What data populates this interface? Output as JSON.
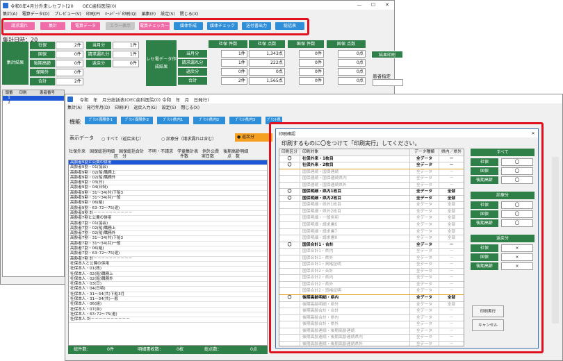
{
  "win1": {
    "title": "令和0年4月分外来レセプト[20　　OEC歯科医院(0)",
    "menu": [
      "集計(A)",
      "電算データ(D)",
      "プレビュー(V)",
      "印刷(P)",
      "ﾎｰﾑﾍﾟｰｼﾞ印刷(Q)",
      "編集(E)",
      "設定(S)",
      "閉じる(X)"
    ],
    "buttons": [
      "請求漏れ",
      "集計",
      "電算データ",
      "エラー表示",
      "電算チェッカー",
      "媒体作成",
      "媒体チェック",
      "送付書出力",
      "総括表"
    ],
    "date_label": "集計日時：20",
    "summary": {
      "group_label": "集計結果",
      "rows": [
        {
          "label": "社保",
          "value": "2件"
        },
        {
          "label": "国保",
          "value": "0件"
        },
        {
          "label": "後期高齢",
          "value": "0件"
        },
        {
          "label": "保険外",
          "value": "0件"
        },
        {
          "label": "合計",
          "value": "2件"
        }
      ],
      "col2": [
        {
          "label": "当月分",
          "value": "1件"
        },
        {
          "label": "請求漏れ分",
          "value": "1件"
        },
        {
          "label": "返戻分",
          "value": "0件"
        }
      ]
    },
    "rezept": {
      "group_label": "レセ電データ作成結果",
      "headers": [
        "社保 件数",
        "社保 点数",
        "国保 件数",
        "国保 点数"
      ],
      "rows": [
        {
          "label": "当月分",
          "v": [
            "1件",
            "1,343点",
            "0件",
            "0点"
          ]
        },
        {
          "label": "請求漏れ分",
          "v": [
            "1件",
            "222点",
            "0件",
            "0点"
          ]
        },
        {
          "label": "返戻分",
          "v": [
            "0件",
            "0点",
            "0件",
            "0点"
          ]
        },
        {
          "label": "合計",
          "v": [
            "2件",
            "1,565点",
            "0件",
            "0点"
          ]
        }
      ]
    },
    "print_btn": "結果印刷",
    "patient_label": "患者指定",
    "grid_headers": [
      "頭番",
      "印刷",
      "患者番号"
    ],
    "grid_rows": [
      [
        "1",
        "",
        ""
      ],
      [
        "2",
        "",
        ""
      ]
    ]
  },
  "win2": {
    "title": "　令和　年　月分総括表(OEC歯科医院(0)   令和　年　月　日発行)",
    "menu": [
      "集計(A)",
      "発行年月(D)",
      "印刷(P)",
      "返戻入力(G)",
      "設定(S)",
      "閉じる(X)"
    ],
    "func_label": "機能",
    "func_buttons": [
      "ﾌﾟﾘﾝﾄ保険外1",
      "ﾌﾟﾘﾝﾄ保険外2",
      "ﾌﾟﾘﾝﾄ県内1",
      "ﾌﾟﾘﾝﾄ県内2",
      "ﾌﾟﾘﾝﾄ県内3",
      "ﾌﾟﾘﾝﾄ県外4"
    ],
    "display_label": "表示データ",
    "radios": [
      "すべて（返戻含む）",
      "診療分（請求漏れは含む）",
      "返戻分"
    ],
    "tabs": [
      "社保外来",
      "国保総括明細",
      "国保総括合計",
      "不明・不請求",
      "学童集計表",
      "例外公費",
      "後期高齢明細"
    ],
    "table_headers": [
      "区　分",
      "件数",
      "実日数",
      "点　数"
    ],
    "rows": [
      "高齢者9割と公費の併用",
      "高齢者9割・01(協会)",
      "高齢者9割・02(船)職務上",
      "高齢者9割・02(船)職務外",
      "高齢者9割・03(日)",
      "高齢者9割・04(日特)",
      "高齢者9割・31～34(共)下船3",
      "高齢者9割・31～34(共)一般",
      "高齢者9割・06(組)",
      "高齢者9割・63･72～75(退)",
      "高齢者9割 計－－－－－－－－－－",
      "高齢者7割と公費の併用",
      "高齢者7割・01(協会)",
      "高齢者7割・02(船)職務上",
      "高齢者7割・02(船)職務外",
      "高齢者7割・31～34(共)下船3",
      "高齢者7割・31～34(共)一般",
      "高齢者7割・06(組)",
      "高齢者7割・63･72～75(退)",
      "高齢者7割 計－－－－－－－－－－",
      "社保本人と公費の併用",
      "社保本人・01(政)",
      "社保本人・02(船)職務上",
      "社保本人・02(船)職務外",
      "社保本人・03(日)",
      "社保本人・04(日特)",
      "社保本人・31～34(共)下船3月",
      "社保本人・31～34(共)一般",
      "社保本人・06(組)",
      "社保本人・07(自)",
      "社保本人・63･72～75(退)",
      "社保本人 計－－－－－－－－－－"
    ],
    "footer": {
      "total_label": "総件数：",
      "total": "0件",
      "detail_label": "明細書枚数：",
      "detail": "0枚",
      "points_label": "総点数：",
      "points": "0点"
    }
  },
  "dialog": {
    "title": "印刷確認",
    "instruction": "印刷するものに〇をつけて「印刷実行」してください。",
    "headers": [
      "印刷区分",
      "印刷対象",
      "データ種類",
      "県内／県外"
    ],
    "rows": [
      {
        "mark": "〇",
        "name": "社保外来・1枚目",
        "type": "全データ",
        "area": "－",
        "style": "b"
      },
      {
        "mark": "〇",
        "name": "社保外来・2枚目",
        "type": "全データ",
        "area": "－",
        "style": "b hl"
      },
      {
        "mark": "",
        "name": "国保連続・国保連続",
        "type": "全データ",
        "area": "－",
        "style": "gy"
      },
      {
        "mark": "",
        "name": "国保連続・国保連続県内",
        "type": "全データ",
        "area": "－",
        "style": "gy"
      },
      {
        "mark": "",
        "name": "国保連続・国保連続県外",
        "type": "全データ",
        "area": "－",
        "style": "gy"
      },
      {
        "mark": "〇",
        "name": "国保明細・県内1枚目",
        "type": "全データ",
        "area": "全部",
        "style": "b"
      },
      {
        "mark": "〇",
        "name": "国保明細・県内2枚目",
        "type": "全データ",
        "area": "全部",
        "style": "b"
      },
      {
        "mark": "",
        "name": "国保明細・県外1枚目",
        "type": "全データ",
        "area": "全部",
        "style": "gy"
      },
      {
        "mark": "",
        "name": "国保明細・県外2枚目",
        "type": "全データ",
        "area": "全部",
        "style": "gy"
      },
      {
        "mark": "",
        "name": "国保明細・一般併用",
        "type": "全データ",
        "area": "全部",
        "style": "gy"
      },
      {
        "mark": "",
        "name": "国保明細・請求書6",
        "type": "全データ",
        "area": "全部",
        "style": "gy"
      },
      {
        "mark": "",
        "name": "国保明細・請求書7",
        "type": "全データ",
        "area": "全部",
        "style": "gy"
      },
      {
        "mark": "",
        "name": "国保明細・請求書8",
        "type": "全データ",
        "area": "全部",
        "style": "gy"
      },
      {
        "mark": "〇",
        "name": "国保合計1・合計",
        "type": "全データ",
        "area": "－",
        "style": "b"
      },
      {
        "mark": "",
        "name": "国保合計1・県内",
        "type": "全データ",
        "area": "－",
        "style": "gy"
      },
      {
        "mark": "",
        "name": "国保合計1・県外",
        "type": "全データ",
        "area": "－",
        "style": "gy"
      },
      {
        "mark": "",
        "name": "国保合計1・資格証明",
        "type": "全データ",
        "area": "－",
        "style": "gy"
      },
      {
        "mark": "",
        "name": "国保合計2・合計",
        "type": "全データ",
        "area": "－",
        "style": "gy"
      },
      {
        "mark": "",
        "name": "国保合計2・県内",
        "type": "全データ",
        "area": "－",
        "style": "gy"
      },
      {
        "mark": "",
        "name": "国保合計2・県外",
        "type": "全データ",
        "area": "－",
        "style": "gy"
      },
      {
        "mark": "",
        "name": "国保合計2・資格証明",
        "type": "全データ",
        "area": "－",
        "style": "gy hl"
      },
      {
        "mark": "〇",
        "name": "後期高齢明細・県内",
        "type": "全データ",
        "area": "全部",
        "style": "b"
      },
      {
        "mark": "",
        "name": "後期高齢明細・県外",
        "type": "全データ",
        "area": "全部",
        "style": "gy"
      },
      {
        "mark": "",
        "name": "後期高齢合計・合計",
        "type": "全データ",
        "area": "－",
        "style": "gy"
      },
      {
        "mark": "",
        "name": "後期高齢合計・県内",
        "type": "全データ",
        "area": "－",
        "style": "gy"
      },
      {
        "mark": "",
        "name": "後期高齢合計・県外",
        "type": "全データ",
        "area": "－",
        "style": "gy"
      },
      {
        "mark": "",
        "name": "後期高齢連続・後期高齢連続",
        "type": "全データ",
        "area": "－",
        "style": "gy"
      },
      {
        "mark": "",
        "name": "後期高齢連続・後期高齢連続県内",
        "type": "全データ",
        "area": "－",
        "style": "gy"
      },
      {
        "mark": "",
        "name": "後期高齢連続・後期高齢連続県外",
        "type": "全データ",
        "area": "－",
        "style": "gy"
      }
    ],
    "sections": [
      {
        "title": "すべて",
        "items": [
          {
            "label": "社保",
            "mark": "〇"
          },
          {
            "label": "国保",
            "mark": "〇"
          },
          {
            "label": "後期高齢",
            "mark": "〇"
          }
        ]
      },
      {
        "title": "診療分",
        "items": [
          {
            "label": "社保",
            "mark": "〇"
          },
          {
            "label": "国保",
            "mark": "〇"
          },
          {
            "label": "後期高齢",
            "mark": "〇"
          }
        ]
      },
      {
        "title": "返戻分",
        "items": [
          {
            "label": "社保",
            "mark": "×"
          },
          {
            "label": "国保",
            "mark": "×"
          },
          {
            "label": "後期高齢",
            "mark": "×"
          }
        ]
      }
    ],
    "exec_btn": "印刷実行",
    "cancel_btn": "キャンセル"
  }
}
